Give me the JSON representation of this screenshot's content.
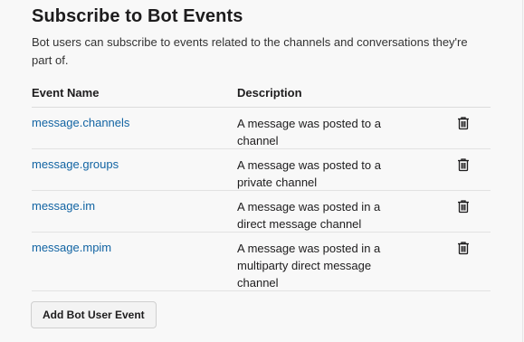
{
  "section": {
    "title": "Subscribe to Bot Events",
    "intro": "Bot users can subscribe to events related to the channels and conversations they're part of."
  },
  "table": {
    "headers": {
      "name": "Event Name",
      "description": "Description"
    },
    "rows": [
      {
        "name": "message.channels",
        "description": "A message was posted to a channel",
        "action_icon": "trash-icon"
      },
      {
        "name": "message.groups",
        "description": "A message was posted to a private channel",
        "action_icon": "trash-icon"
      },
      {
        "name": "message.im",
        "description": "A message was posted in a direct message channel",
        "action_icon": "trash-icon"
      },
      {
        "name": "message.mpim",
        "description": "A message was posted in a multiparty direct message channel",
        "action_icon": "trash-icon"
      }
    ]
  },
  "actions": {
    "add_label": "Add Bot User Event"
  },
  "colors": {
    "link": "#1264a3",
    "text": "#1d1c1d",
    "background": "#f8f8f8"
  }
}
